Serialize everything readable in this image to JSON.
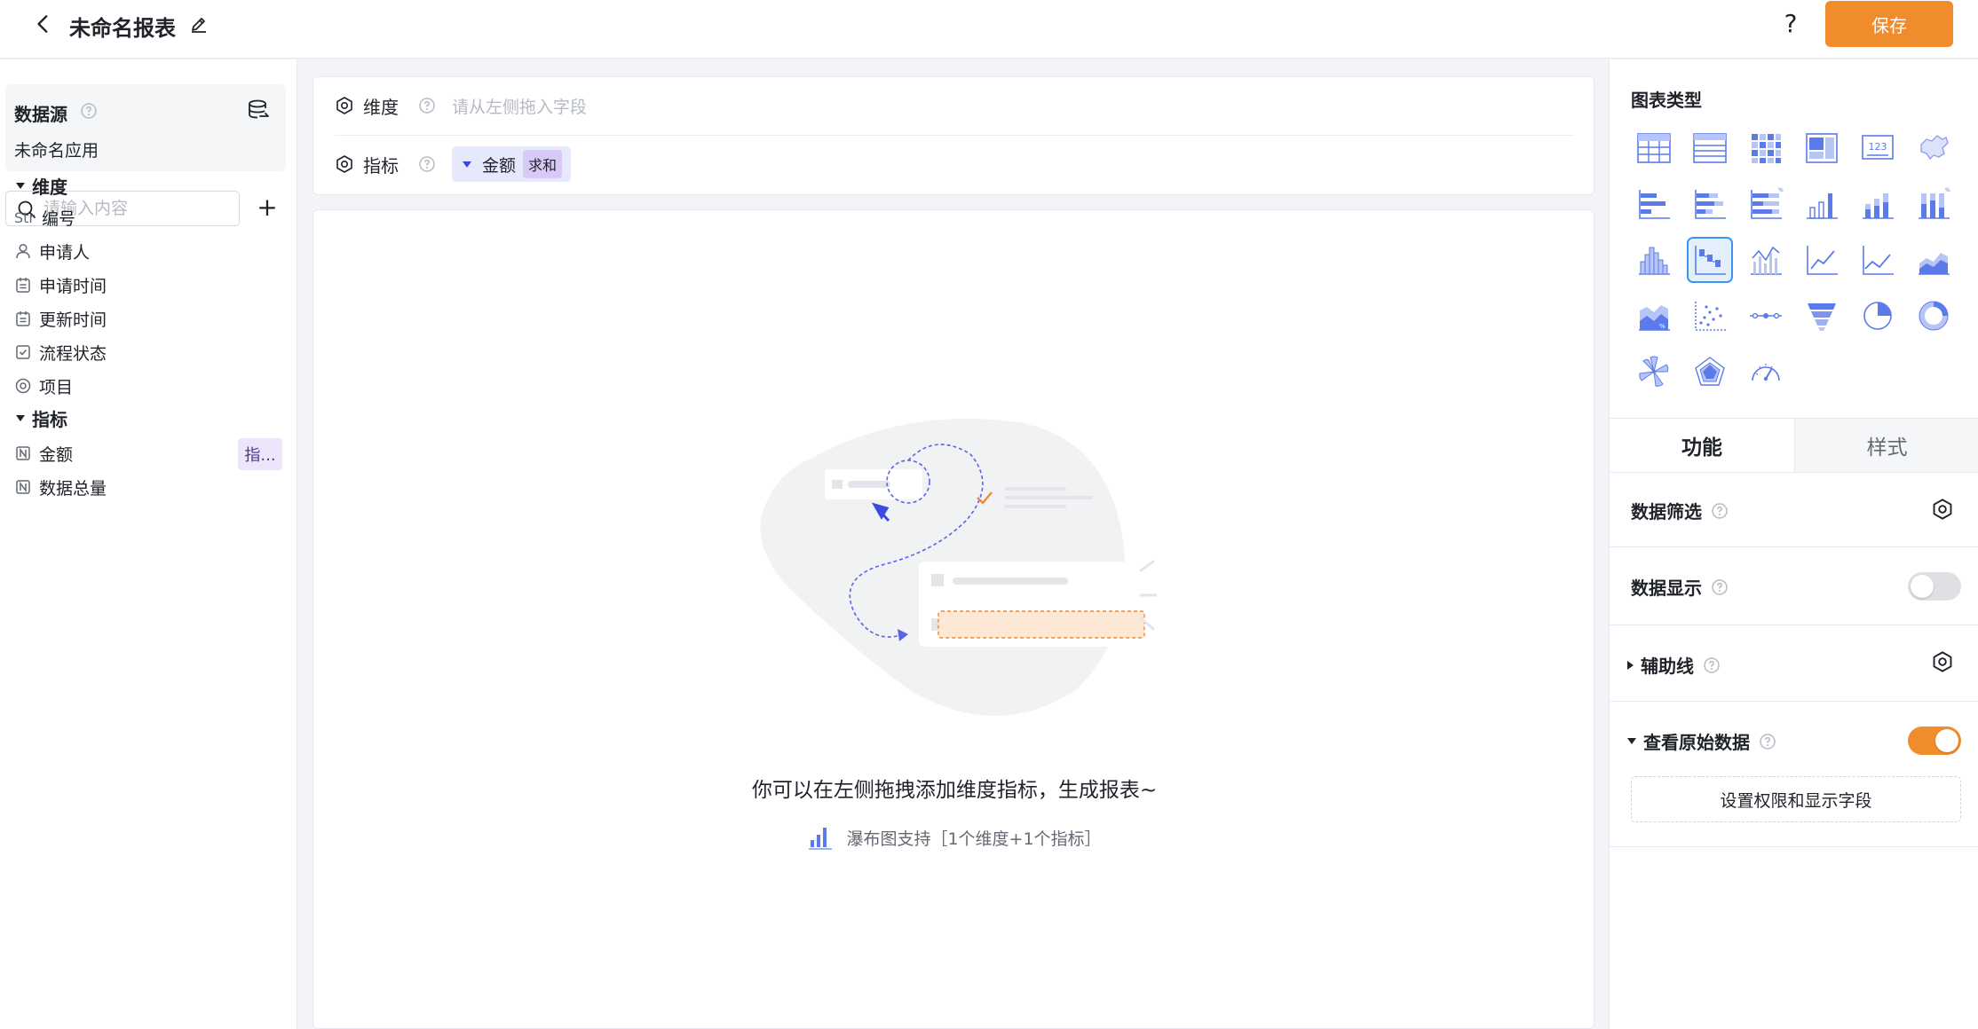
{
  "header": {
    "title": "未命名报表",
    "help_label": "?",
    "save_label": "保存"
  },
  "sidebar": {
    "datasource_title": "数据源",
    "datasource_name": "未命名应用",
    "search_placeholder": "请输入内容",
    "add_label": "+",
    "dimension_group": "维度",
    "dimension_fields": [
      {
        "type_label": "Str",
        "name": "编号",
        "icon": "string-icon"
      },
      {
        "name": "申请人",
        "icon": "user-icon"
      },
      {
        "name": "申请时间",
        "icon": "calendar-icon"
      },
      {
        "name": "更新时间",
        "icon": "calendar-icon"
      },
      {
        "name": "流程状态",
        "icon": "checkbox-icon"
      },
      {
        "name": "项目",
        "icon": "radio-icon"
      }
    ],
    "metric_group": "指标",
    "metric_fields": [
      {
        "name": "金额",
        "icon": "number-icon",
        "tag": "指..."
      },
      {
        "name": "数据总量",
        "icon": "number-icon"
      }
    ]
  },
  "config": {
    "dimension_label": "维度",
    "dimension_placeholder": "请从左侧拖入字段",
    "metric_label": "指标",
    "metric_chip_name": "金额",
    "metric_chip_agg": "求和"
  },
  "canvas": {
    "empty_title": "你可以在左侧拖拽添加维度指标，生成报表~",
    "empty_hint": "瀑布图支持［1个维度+1个指标］"
  },
  "right_panel": {
    "chart_type_title": "图表类型",
    "chart_types": [
      "table-chart-icon",
      "detail-table-icon",
      "pivot-table-icon",
      "layout-chart-icon",
      "kpi-number-icon",
      "map-chart-icon",
      "bar-horizontal-icon",
      "stacked-bar-horizontal-icon",
      "percent-bar-horizontal-icon",
      "column-chart-icon",
      "stacked-column-icon",
      "percent-column-icon",
      "histogram-icon",
      "waterfall-chart-icon",
      "combo-chart-icon",
      "line-chart-icon",
      "area-line-icon",
      "area-chart-icon",
      "percent-area-icon",
      "scatter-chart-icon",
      "timeline-icon",
      "funnel-chart-icon",
      "pie-chart-icon",
      "donut-chart-icon",
      "rose-chart-icon",
      "radar-chart-icon",
      "gauge-chart-icon"
    ],
    "selected_chart": "waterfall-chart-icon",
    "tab_function": "功能",
    "tab_style": "样式",
    "options": {
      "data_filter": "数据筛选",
      "data_display": "数据显示",
      "data_display_on": false,
      "aux_line": "辅助线",
      "view_raw": "查看原始数据",
      "view_raw_on": true,
      "perm_button": "设置权限和显示字段"
    },
    "colors": {
      "accent": "#f08c2b",
      "selection": "#3b93f5",
      "icon_blue": "#5b7bea"
    }
  }
}
